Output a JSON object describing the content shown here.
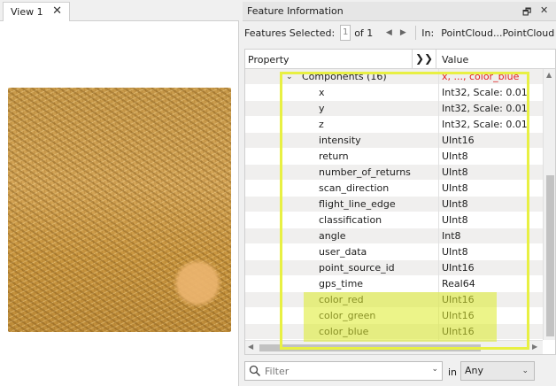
{
  "view": {
    "tab_label": "View 1",
    "close_glyph": "✕"
  },
  "panel": {
    "title": "Feature Information",
    "float_glyph": "🗗",
    "close_glyph": "✕",
    "features_selected_label": "Features Selected:",
    "selected_index": "1",
    "of_label": "of 1",
    "prev_glyph": "◀",
    "next_glyph": "▶",
    "in_label": "In:",
    "source": "PointCloud...PointCloud"
  },
  "grid": {
    "col_property": "Property",
    "expand_glyph": "❯❯",
    "col_value": "Value",
    "group": {
      "name": "Components (16)",
      "value": "x, ..., color_blue",
      "chevron": "⌄"
    },
    "rows": [
      {
        "name": "x",
        "value": "Int32, Scale: 0.01"
      },
      {
        "name": "y",
        "value": "Int32, Scale: 0.01"
      },
      {
        "name": "z",
        "value": "Int32, Scale: 0.01"
      },
      {
        "name": "intensity",
        "value": "UInt16"
      },
      {
        "name": "return",
        "value": "UInt8"
      },
      {
        "name": "number_of_returns",
        "value": "UInt8"
      },
      {
        "name": "scan_direction",
        "value": "UInt8"
      },
      {
        "name": "flight_line_edge",
        "value": "UInt8"
      },
      {
        "name": "classification",
        "value": "UInt8"
      },
      {
        "name": "angle",
        "value": "Int8"
      },
      {
        "name": "user_data",
        "value": "UInt8"
      },
      {
        "name": "point_source_id",
        "value": "UInt16"
      },
      {
        "name": "gps_time",
        "value": "Real64"
      },
      {
        "name": "color_red",
        "value": "UInt16"
      },
      {
        "name": "color_green",
        "value": "UInt16"
      },
      {
        "name": "color_blue",
        "value": "UInt16"
      }
    ]
  },
  "filter": {
    "placeholder": "Filter",
    "in_label": "in",
    "scope_value": "Any",
    "search_icon": "search-icon",
    "dropdown_glyph": "⌄"
  },
  "colors": {
    "highlight": "#e8f043",
    "group_value": "#e02020",
    "cloud": "#c89a4a"
  }
}
